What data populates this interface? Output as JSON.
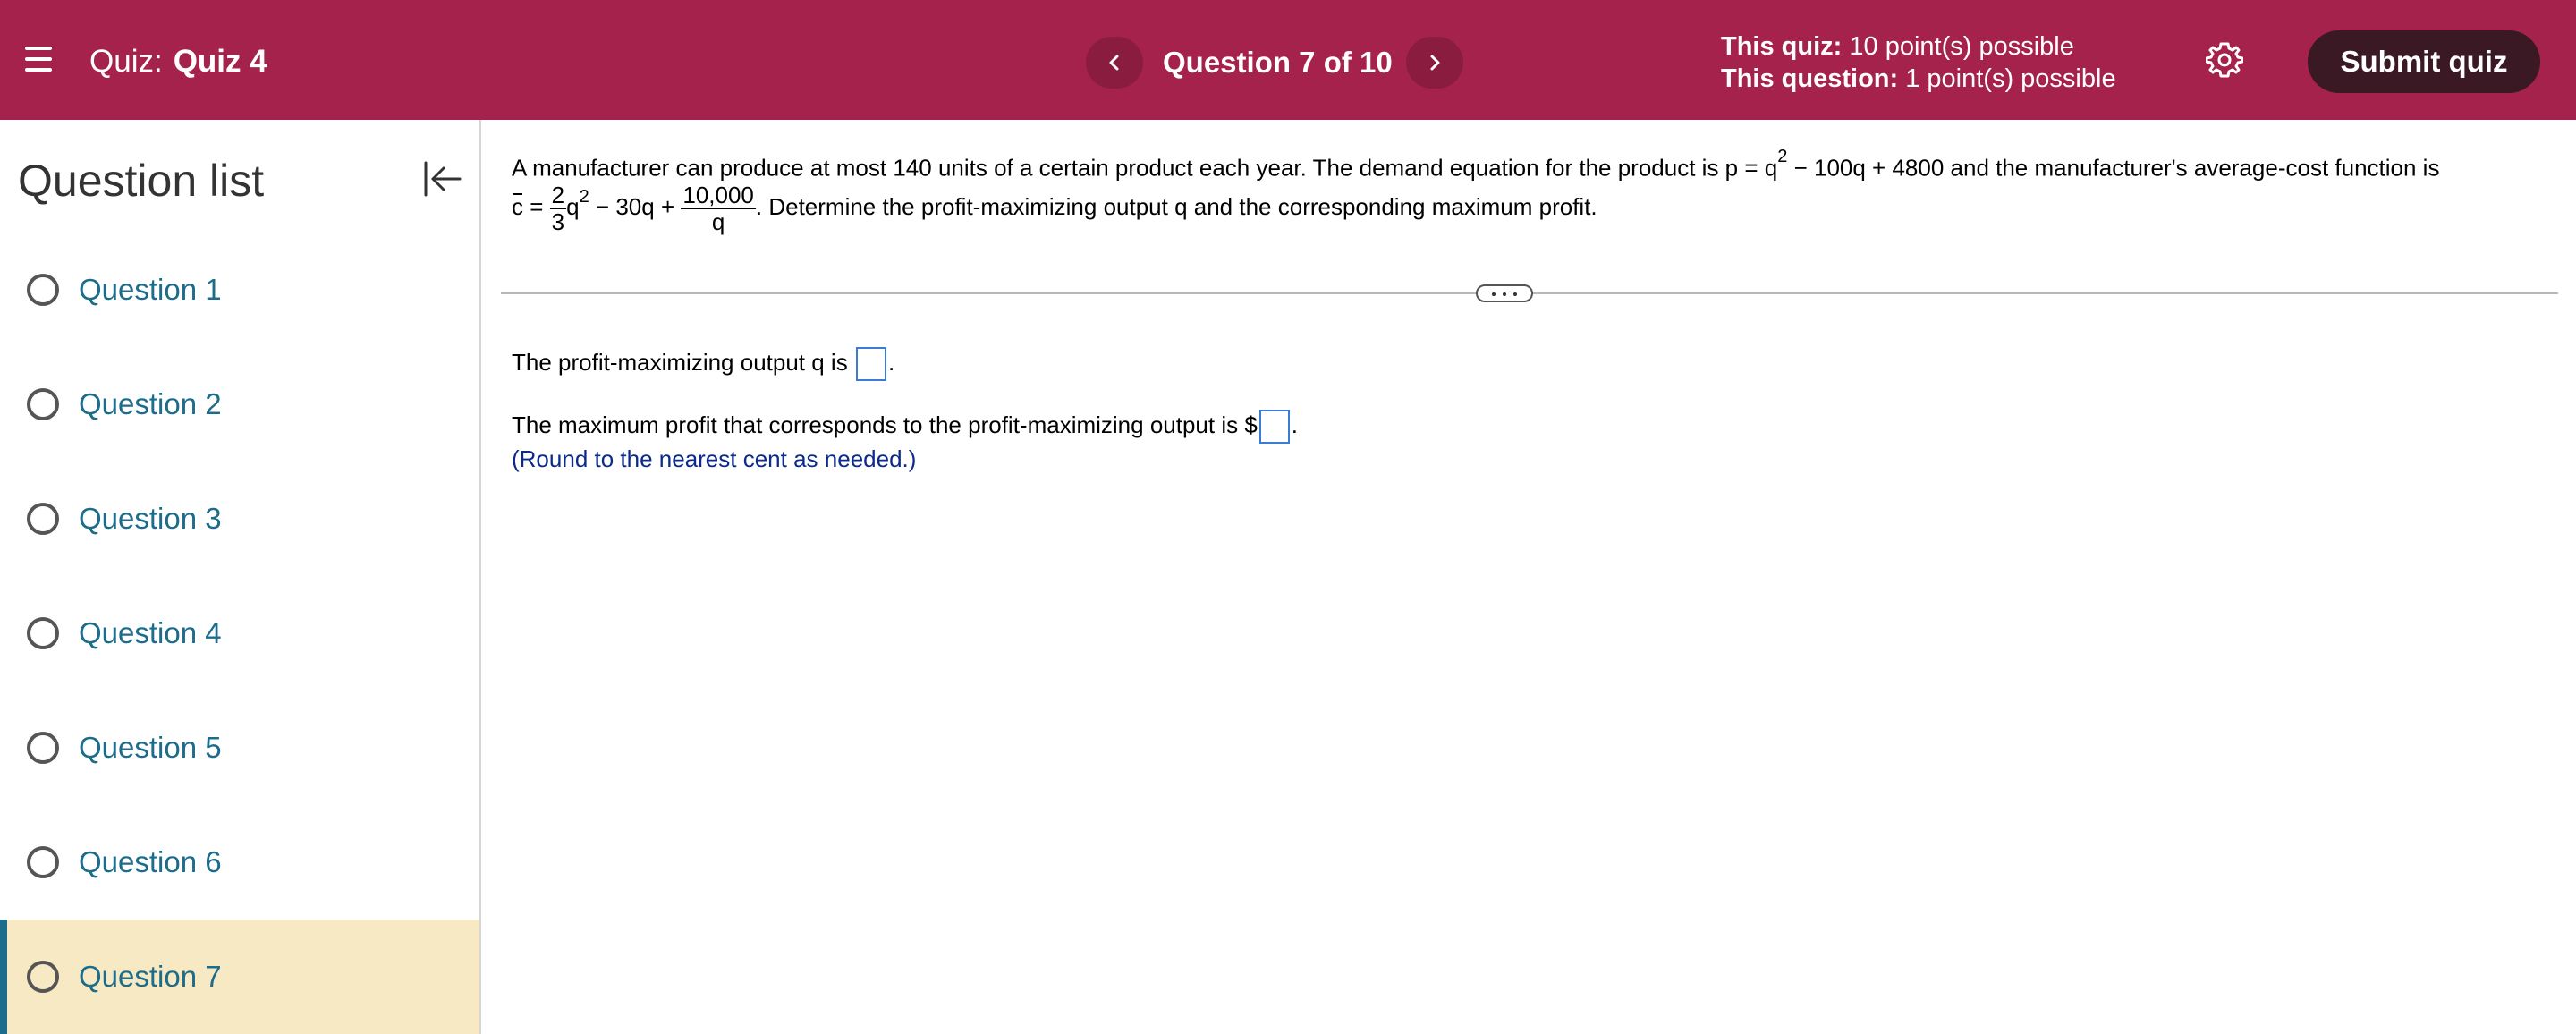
{
  "header": {
    "quiz_prefix": "Quiz:",
    "quiz_name": "Quiz 4",
    "question_indicator": "Question 7 of 10",
    "quiz_points_label": "This quiz:",
    "quiz_points_value": "10 point(s) possible",
    "question_points_label": "This question:",
    "question_points_value": "1 point(s) possible",
    "submit_label": "Submit quiz"
  },
  "sidebar": {
    "title": "Question list",
    "items": [
      {
        "label": "Question 1"
      },
      {
        "label": "Question 2"
      },
      {
        "label": "Question 3"
      },
      {
        "label": "Question 4"
      },
      {
        "label": "Question 5"
      },
      {
        "label": "Question 6"
      },
      {
        "label": "Question 7"
      }
    ]
  },
  "question": {
    "line1_before": "A manufacturer can produce at most 140 units of a certain product each year. The demand equation for the product is p = q",
    "line1_sup": "2",
    "line1_after": " − 100q + 4800 and the manufacturer's average-cost function is",
    "c_symbol": "c",
    "equals": " = ",
    "frac1_num": "2",
    "frac1_den": "3",
    "q_var": "q",
    "q_sup": "2",
    "mid_terms": " − 30q + ",
    "frac2_num": "10,000",
    "frac2_den": "q",
    "line2_after": ". Determine the profit-maximizing output q and the corresponding maximum profit."
  },
  "answers": {
    "output_label": "The profit-maximizing output q is ",
    "output_value": "",
    "profit_label": "The maximum profit that corresponds to the profit-maximizing output is $",
    "profit_value": "",
    "period": ".",
    "hint": "(Round to the nearest cent as needed.)"
  },
  "colors": {
    "header_bg": "#a4224b",
    "submit_bg": "#3a1824",
    "active_item_bg": "#f7e9c4",
    "link_color": "#1c6c8c",
    "hint_color": "#0b2a8a"
  },
  "icons": [
    "menu-icon",
    "chevron-left-icon",
    "chevron-right-icon",
    "gear-icon",
    "collapse-sidebar-icon",
    "radio-icon",
    "more-handle-icon"
  ]
}
